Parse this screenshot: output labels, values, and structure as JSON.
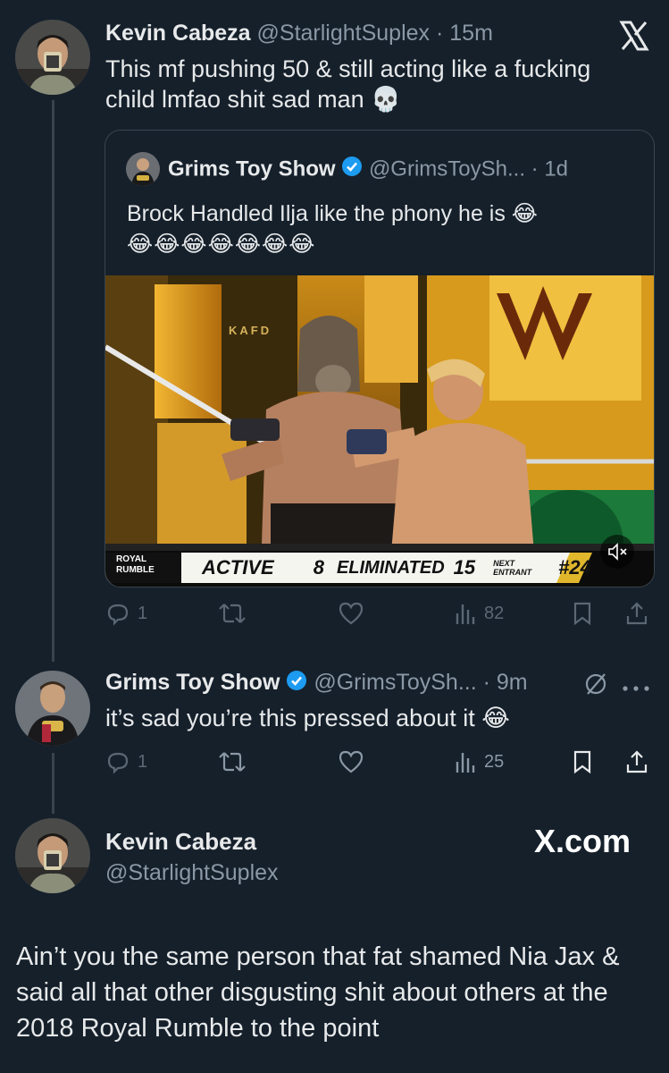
{
  "tweet1": {
    "author_name": "Kevin Cabeza",
    "handle_time": "@StarlightSuplex · 15m",
    "text": "This mf pushing 50 & still acting like a fucking child lmfao shit sad man 💀"
  },
  "x_logo_glyph": "𝕏",
  "quote": {
    "author_name": "Grims Toy Show",
    "handle_time": "@GrimsToySh... · 1d",
    "text_line1": "Brock Handled Ilja like the phony he is 😂",
    "text_line2": "😂😂😂😂😂😂😂",
    "scoreboard": {
      "brand_line1": "ROYAL",
      "brand_line2": "RUMBLE",
      "active_label": "ACTIVE",
      "active_value": "8",
      "eliminated_label": "ELIMINATED",
      "eliminated_value": "15",
      "next_line1": "NEXT",
      "next_line2": "ENTRANT",
      "entrant": "#24"
    },
    "tv_sign": "KAFD"
  },
  "tweet1_actions": {
    "replies": "1",
    "reposts": "",
    "likes": "",
    "views": "82"
  },
  "tweet2": {
    "author_name": "Grims Toy Show",
    "handle_time": "@GrimsToySh... · 9m",
    "text": "it’s sad you’re this pressed about it 😂"
  },
  "tweet2_actions": {
    "replies": "1",
    "reposts": "",
    "likes": "",
    "views": "25"
  },
  "tweet3": {
    "author_name": "Kevin Cabeza",
    "handle": "@StarlightSuplex",
    "watermark": "X.com",
    "text": "Ain’t you the same person that fat shamed Nia Jax & said all that other disgusting shit about others at the 2018 Royal Rumble to the point"
  },
  "colors": {
    "background": "#15202b",
    "muted": "#8b98a5",
    "verified": "#1d9bf0",
    "border": "#38444d"
  }
}
